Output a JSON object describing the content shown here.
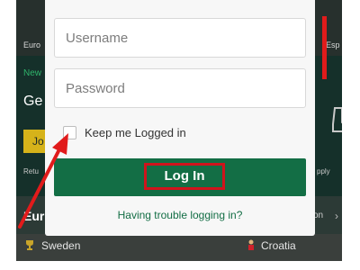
{
  "background": {
    "tab_left": "Euro",
    "tab_right": "Esp",
    "promo_tag": "New",
    "promo_heading": "Ge",
    "promo_button": "Jo",
    "promo_footer_left": "Retu",
    "promo_footer_right": "pply",
    "section_title": "Eur",
    "section_link": "on",
    "team_left": "Sweden",
    "team_right": "Croatia"
  },
  "login": {
    "username_placeholder": "Username",
    "password_placeholder": "Password",
    "keep_logged_label": "Keep me Logged in",
    "keep_logged_checked": false,
    "login_button_label": "Log In",
    "trouble_link": "Having trouble logging in?"
  },
  "colors": {
    "brand_green": "#136e45",
    "annotation_red": "#e11b1b",
    "promo_yellow": "#d6b31a"
  },
  "icons": [
    "trophy-icon",
    "player-icon",
    "boot-icon",
    "chevron-right-icon"
  ]
}
